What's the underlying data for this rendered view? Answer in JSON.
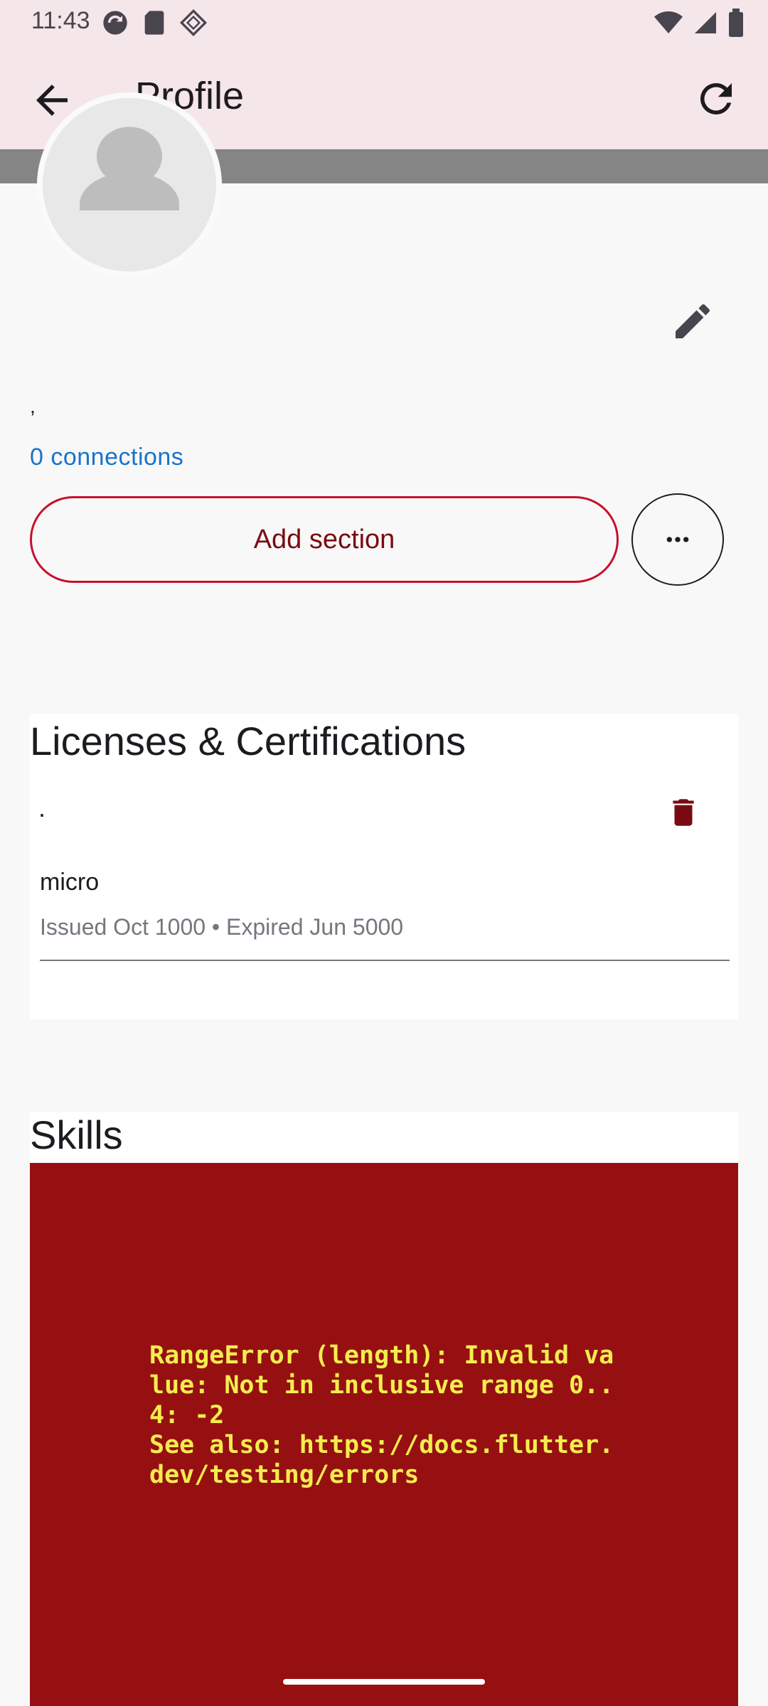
{
  "status_bar": {
    "time": "11:43",
    "left_icons": [
      "sync-icon",
      "sd-card-icon",
      "sparkle-icon"
    ],
    "right_icons": [
      "wifi-icon",
      "signal-icon",
      "battery-icon"
    ]
  },
  "app_bar": {
    "title": "Profile",
    "back_icon": "arrow-back-icon",
    "refresh_icon": "refresh-icon"
  },
  "profile": {
    "name_line": ",",
    "connections_label": "0 connections",
    "add_section_label": "Add section",
    "more_icon": "more-horiz-icon",
    "edit_icon": "pencil-icon"
  },
  "licenses": {
    "heading": "Licenses & Certifications",
    "items": [
      {
        "title": ".",
        "name": "micro",
        "dates": "Issued Oct 1000 • Expired Jun 5000",
        "delete_icon": "trash-icon"
      }
    ]
  },
  "skills": {
    "heading": "Skills",
    "error_message": "RangeError (length): Invalid value: Not in inclusive range 0..4: -2\nSee also: https://docs.flutter.dev/testing/errors"
  },
  "colors": {
    "app_bar_bg": "#f5e6ea",
    "accent_red": "#c8102e",
    "link_blue": "#1a73c9",
    "error_bg": "#961012",
    "error_text": "#f4ec4e"
  }
}
